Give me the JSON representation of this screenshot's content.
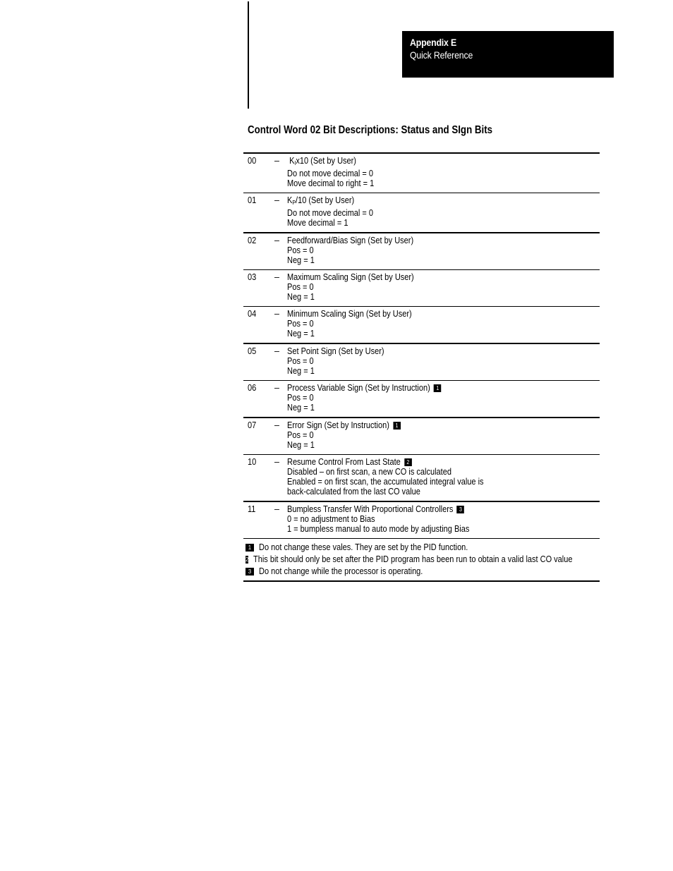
{
  "header": {
    "appendix": "Appendix E",
    "section": "Quick Reference"
  },
  "title": "Control Word 02 Bit Descriptions: Status and SIgn Bits",
  "dash": "–",
  "rows": [
    {
      "bit": "00",
      "heading_prefix": "K",
      "heading_sub": "I",
      "heading_suffix": "x10 (Set by User)",
      "note": "",
      "lines": [
        "Do not move decimal = 0",
        "Move decimal to right = 1"
      ]
    },
    {
      "bit": "01",
      "heading_prefix": "K",
      "heading_sub": "P",
      "heading_suffix": "/10 (Set by User)",
      "note": "",
      "lines": [
        "Do not move decimal = 0",
        "Move decimal = 1"
      ]
    },
    {
      "bit": "02",
      "heading": "Feedforward/Bias Sign (Set by User)",
      "note": "",
      "lines": [
        "Pos = 0",
        "Neg = 1"
      ]
    },
    {
      "bit": "03",
      "heading": "Maximum Scaling Sign (Set by User)",
      "note": "",
      "lines": [
        "Pos = 0",
        "Neg = 1"
      ]
    },
    {
      "bit": "04",
      "heading": "Minimum Scaling Sign (Set by User)",
      "note": "",
      "lines": [
        "Pos = 0",
        "Neg = 1"
      ]
    },
    {
      "bit": "05",
      "heading": "Set Point Sign (Set by User)",
      "note": "",
      "lines": [
        "Pos = 0",
        "Neg = 1"
      ]
    },
    {
      "bit": "06",
      "heading": "Process Variable Sign (Set by Instruction)",
      "note": "1",
      "lines": [
        "Pos = 0",
        "Neg = 1"
      ]
    },
    {
      "bit": "07",
      "heading": "Error Sign (Set by Instruction)",
      "note": "1",
      "lines": [
        "Pos = 0",
        "Neg = 1"
      ]
    },
    {
      "bit": "10",
      "heading": "Resume Control From Last State",
      "note": "2",
      "lines": [
        "Disabled – on first scan, a new CO is calculated",
        "Enabled = on first scan, the accumulated integral value is",
        "back-calculated from the last CO value"
      ]
    },
    {
      "bit": "11",
      "heading": "Bumpless Transfer With Proportional Controllers",
      "note": "3",
      "lines": [
        "0 = no adjustment to Bias",
        "1 = bumpless manual to auto mode by adjusting Bias"
      ]
    }
  ],
  "footnotes": [
    {
      "num": "1",
      "text": "Do not change these vales.  They are set by the PID function."
    },
    {
      "num": "2",
      "text": "This bit should only be set after the PID program has been run to obtain a valid last CO value"
    },
    {
      "num": "3",
      "text": "Do not change while the processor is operating."
    }
  ]
}
